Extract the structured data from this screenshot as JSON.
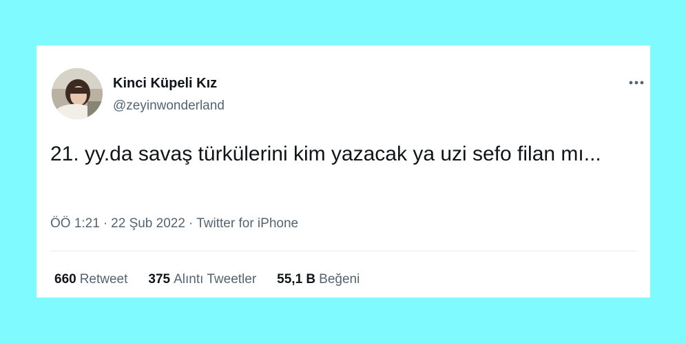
{
  "tweet": {
    "author_name": "Kinci Küpeli Kız",
    "handle": "@zeyinwonderland",
    "text": "21. yy.da savaş türkülerini kim yazacak ya uzi sefo filan mı...",
    "time": "ÖÖ 1:21",
    "date": "22 Şub 2022",
    "source": "Twitter for iPhone",
    "separator": "·",
    "more_icon": "more-horizontal-icon"
  },
  "stats": [
    {
      "count": "660",
      "label": "Retweet"
    },
    {
      "count": "375",
      "label": "Alıntı Tweetler"
    },
    {
      "count": "55,1 B",
      "label": "Beğeni"
    }
  ],
  "colors": {
    "background": "#7ffbff",
    "card": "#ffffff",
    "primary_text": "#0f1419",
    "secondary_text": "#536471",
    "divider": "#e6ecf0"
  }
}
